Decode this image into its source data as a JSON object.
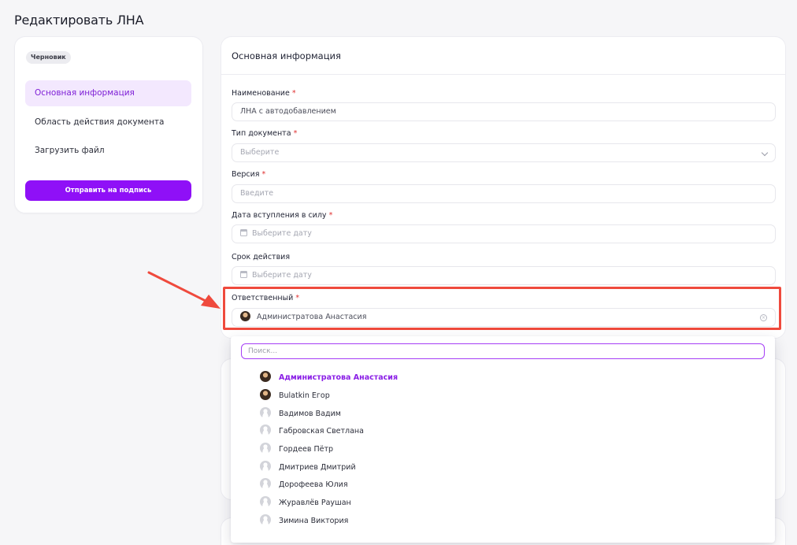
{
  "page": {
    "title": "Редактировать ЛНА"
  },
  "sidebar": {
    "status_badge": "Черновик",
    "items": [
      {
        "label": "Основная информация",
        "active": true
      },
      {
        "label": "Область действия документа",
        "active": false
      },
      {
        "label": "Загрузить файл",
        "active": false
      }
    ],
    "submit_label": "Отправить на подпись"
  },
  "form": {
    "header": "Основная информация",
    "required_mark": "*",
    "fields": {
      "name": {
        "label": "Наименование",
        "value": "ЛНА с автодобавлением"
      },
      "doc_type": {
        "label": "Тип документа",
        "placeholder": "Выберите"
      },
      "version": {
        "label": "Версия",
        "placeholder": "Введите"
      },
      "effective_date": {
        "label": "Дата вступления в силу",
        "placeholder": "Выберите дату"
      },
      "validity": {
        "label": "Срок действия",
        "placeholder": "Выберите дату"
      },
      "responsible": {
        "label": "Ответственный",
        "value": "Администратова Анастасия"
      }
    }
  },
  "dropdown": {
    "search_placeholder": "Поиск...",
    "options": [
      {
        "label": "Администратова Анастасия",
        "avatar": "photo",
        "selected": true
      },
      {
        "label": "Bulatkin Егор",
        "avatar": "photo",
        "selected": false
      },
      {
        "label": "Вадимов Вадим",
        "avatar": "default",
        "selected": false
      },
      {
        "label": "Габровская Светлана",
        "avatar": "default",
        "selected": false
      },
      {
        "label": "Гордеев Пётр",
        "avatar": "default",
        "selected": false
      },
      {
        "label": "Дмитриев Дмитрий",
        "avatar": "default",
        "selected": false
      },
      {
        "label": "Дорофеева Юлия",
        "avatar": "default",
        "selected": false
      },
      {
        "label": "Журавлёв Раушан",
        "avatar": "default",
        "selected": false
      },
      {
        "label": "Зимина Виктория",
        "avatar": "default",
        "selected": false
      }
    ]
  },
  "colors": {
    "accent": "#8f10f7",
    "highlight": "#ef4a3d",
    "required": "#e03131"
  }
}
